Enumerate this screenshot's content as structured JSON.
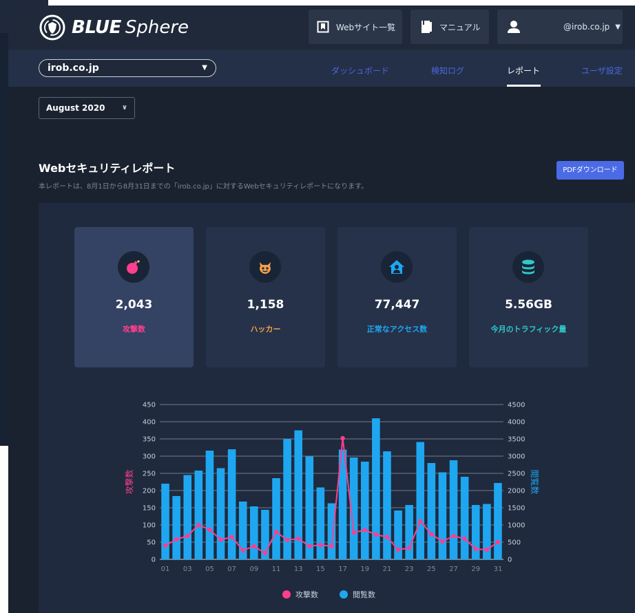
{
  "header": {
    "logo_brand": "BLUE",
    "logo_product": "Sphere",
    "websites_label": "Webサイト一覧",
    "manual_label": "マニュアル",
    "user_label": "@irob.co.jp"
  },
  "subnav": {
    "domain": "irob.co.jp",
    "tabs": [
      {
        "label": "ダッシュボード",
        "active": false
      },
      {
        "label": "検知ログ",
        "active": false
      },
      {
        "label": "レポート",
        "active": true
      },
      {
        "label": "ユーザ設定",
        "active": false
      }
    ]
  },
  "month": "August 2020",
  "report": {
    "title": "Webセキュリティレポート",
    "description": "本レポートは、8月1日から8月31日までの「irob.co.jp」に対するWebセキュリティレポートになります。",
    "pdf_label": "PDFダウンロード"
  },
  "stats": [
    {
      "value": "2,043",
      "label": "攻撃数",
      "icon": "bomb-icon",
      "color": "#ff3f8e"
    },
    {
      "value": "1,158",
      "label": "ハッカー",
      "icon": "devil-face-icon",
      "color": "#f0a04b"
    },
    {
      "value": "77,447",
      "label": "正常なアクセス数",
      "icon": "home-user-icon",
      "color": "#1ea7f0"
    },
    {
      "value": "5.56GB",
      "label": "今月のトラフィック量",
      "icon": "database-icon",
      "color": "#2ec9c9"
    }
  ],
  "colors": {
    "attack": "#ff3f8e",
    "views": "#1ea7f0",
    "pdf_button": "#4b6be6",
    "nav_link": "#4c66e0"
  },
  "chart_data": {
    "type": "bar+line",
    "categories": [
      "01",
      "02",
      "03",
      "04",
      "05",
      "06",
      "07",
      "08",
      "09",
      "10",
      "11",
      "12",
      "13",
      "14",
      "15",
      "16",
      "17",
      "18",
      "19",
      "20",
      "21",
      "22",
      "23",
      "24",
      "25",
      "26",
      "27",
      "28",
      "29",
      "30",
      "31"
    ],
    "x_tick_labels": [
      "01",
      "03",
      "05",
      "07",
      "09",
      "11",
      "13",
      "15",
      "17",
      "19",
      "21",
      "23",
      "25",
      "27",
      "29",
      "31"
    ],
    "left_axis": {
      "label": "攻撃数",
      "ylim": [
        0,
        450
      ],
      "ticks": [
        "0",
        "50",
        "100",
        "150",
        "200",
        "250",
        "300",
        "350",
        "400",
        "450"
      ]
    },
    "right_axis": {
      "label": "閲覧数",
      "ylim": [
        0,
        4500
      ],
      "ticks": [
        "0",
        "500",
        "1000",
        "1500",
        "2000",
        "2500",
        "3000",
        "3500",
        "4000",
        "4500"
      ]
    },
    "grid": true,
    "legend_position": "bottom",
    "series": [
      {
        "name": "攻撃数",
        "type": "line",
        "axis": "left",
        "values": [
          40,
          58,
          68,
          100,
          86,
          57,
          65,
          26,
          38,
          18,
          80,
          56,
          60,
          38,
          42,
          38,
          352,
          78,
          85,
          72,
          65,
          28,
          33,
          111,
          73,
          52,
          68,
          60,
          30,
          28,
          50
        ]
      },
      {
        "name": "閲覧数",
        "type": "bar",
        "axis": "right",
        "values": [
          2200,
          1840,
          2450,
          2580,
          3160,
          2650,
          3200,
          1680,
          1540,
          1440,
          2360,
          3500,
          3750,
          2990,
          2090,
          1630,
          3190,
          2960,
          2840,
          4100,
          3140,
          1420,
          1580,
          3410,
          2800,
          2530,
          2880,
          2400,
          1580,
          1610,
          2220
        ]
      }
    ]
  }
}
